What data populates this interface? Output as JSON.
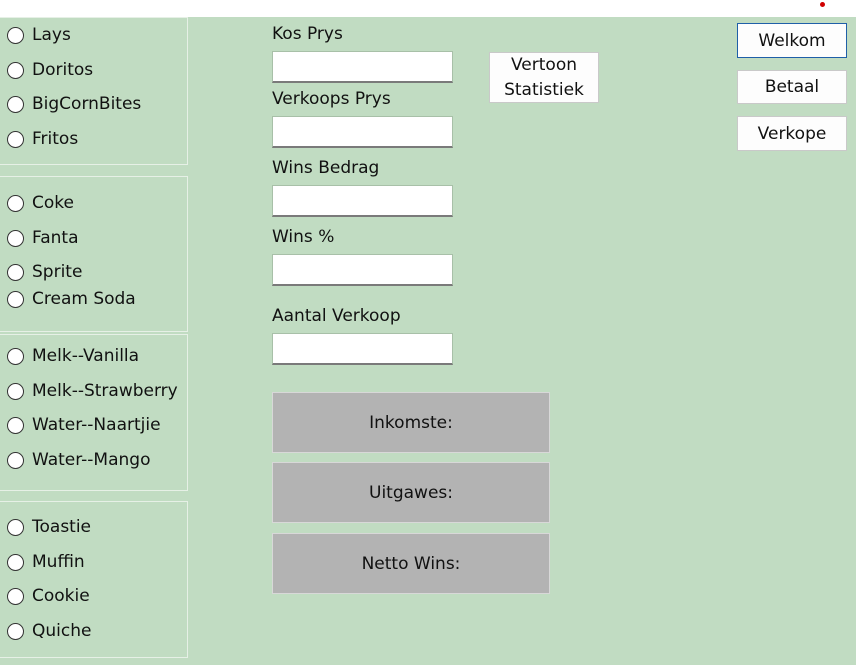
{
  "radio_groups": [
    {
      "items": [
        "Lays",
        "Doritos",
        "BigCornBites",
        "Fritos"
      ]
    },
    {
      "items": [
        "Coke",
        "Fanta",
        "Sprite",
        "Cream Soda"
      ]
    },
    {
      "items": [
        "Melk--Vanilla",
        "Melk--Strawberry",
        "Water--Naartjie",
        "Water--Mango"
      ]
    },
    {
      "items": [
        "Toastie",
        "Muffin",
        "Cookie",
        "Quiche"
      ]
    }
  ],
  "fields": {
    "kos_prys": {
      "label": "Kos Prys",
      "value": ""
    },
    "verkoops_prys": {
      "label": "Verkoops Prys",
      "value": ""
    },
    "wins_bedrag": {
      "label": "Wins Bedrag",
      "value": ""
    },
    "wins_pct": {
      "label": "Wins %",
      "value": ""
    },
    "aantal_verkoop": {
      "label": "Aantal Verkoop",
      "value": ""
    }
  },
  "buttons": {
    "vertoon_line1": "Vertoon",
    "vertoon_line2": "Statistiek",
    "welkom": "Welkom",
    "betaal": "Betaal",
    "verkope": "Verkope"
  },
  "panels": {
    "inkomste": "Inkomste:",
    "uitgawes": "Uitgawes:",
    "netto_wins": "Netto Wins:"
  },
  "colors": {
    "background": "#c1dcc2",
    "panel": "#b3b3b3",
    "accent_border": "#1f5fa8",
    "indicator": "#d00000"
  }
}
